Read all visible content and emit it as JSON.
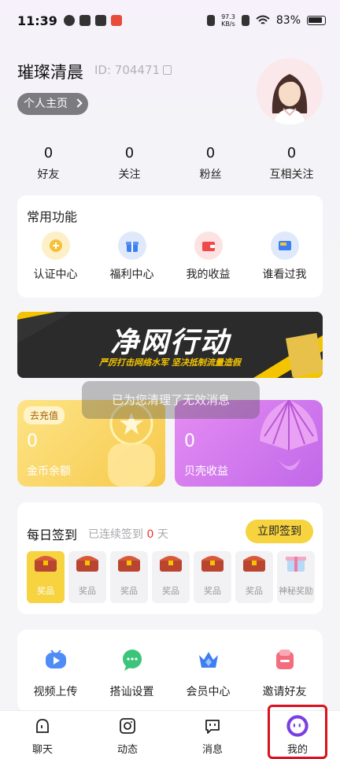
{
  "status_bar": {
    "time": "11:39",
    "net_speed_value": "97.3",
    "net_speed_unit": "KB/s",
    "battery": "83%"
  },
  "profile": {
    "username": "璀璨清晨",
    "id_text": "ID: 704471",
    "home_button": "个人主页"
  },
  "stats": [
    {
      "num": "0",
      "label": "好友"
    },
    {
      "num": "0",
      "label": "关注"
    },
    {
      "num": "0",
      "label": "粉丝"
    },
    {
      "num": "0",
      "label": "互相关注"
    }
  ],
  "common_functions": {
    "title": "常用功能",
    "items": [
      {
        "label": "认证中心",
        "icon": "certification-icon"
      },
      {
        "label": "福利中心",
        "icon": "gift-icon"
      },
      {
        "label": "我的收益",
        "icon": "wallet-icon"
      },
      {
        "label": "谁看过我",
        "icon": "visitor-card-icon"
      }
    ]
  },
  "banner": {
    "title": "净网行动",
    "subtitle": "严厉打击网络水军  坚决抵制流量造假"
  },
  "toast": "已为您清理了无效消息",
  "wallet": {
    "gold": {
      "tag": "去充值",
      "value": "0",
      "label": "金币余额"
    },
    "shell": {
      "value": "0",
      "label": "贝壳收益"
    }
  },
  "daily_signin": {
    "title": "每日签到",
    "sub_prefix": "已连续签到",
    "days": "0",
    "sub_suffix": "天",
    "button": "立即签到",
    "rewards": [
      "奖品",
      "奖品",
      "奖品",
      "奖品",
      "奖品",
      "奖品",
      "神秘奖励"
    ]
  },
  "tools": [
    {
      "label": "视频上传",
      "icon": "video-upload-icon"
    },
    {
      "label": "搭讪设置",
      "icon": "chat-bubble-icon"
    },
    {
      "label": "会员中心",
      "icon": "crown-icon"
    },
    {
      "label": "邀请好友",
      "icon": "invite-icon"
    }
  ],
  "nav": [
    {
      "label": "聊天",
      "icon": "chat-icon"
    },
    {
      "label": "动态",
      "icon": "camera-icon"
    },
    {
      "label": "消息",
      "icon": "message-icon"
    },
    {
      "label": "我的",
      "icon": "profile-icon"
    }
  ],
  "colors": {
    "accent_yellow": "#f6d33f",
    "highlight_red": "#d8121e",
    "purple": "#7a3fe0"
  }
}
